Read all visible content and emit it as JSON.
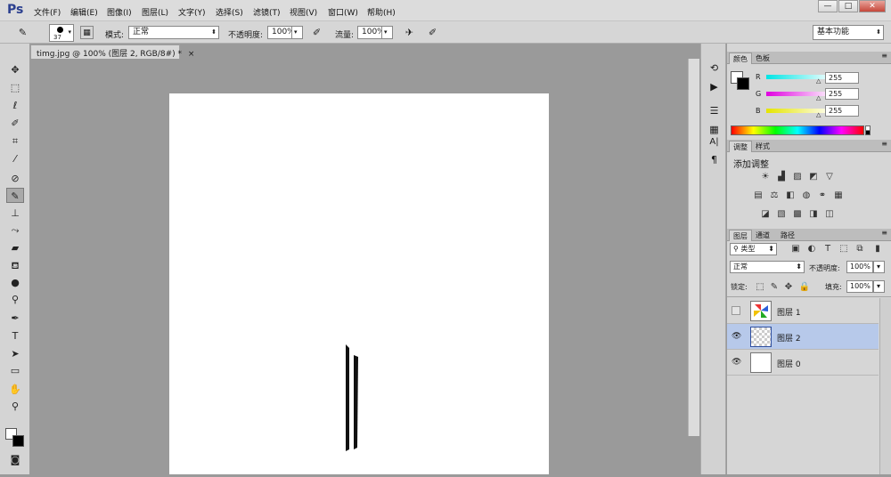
{
  "app": {
    "logo": "Ps"
  },
  "menu": [
    "文件(F)",
    "编辑(E)",
    "图像(I)",
    "图层(L)",
    "文字(Y)",
    "选择(S)",
    "滤镜(T)",
    "视图(V)",
    "窗口(W)",
    "帮助(H)"
  ],
  "window_controls": {
    "minimize": "—",
    "maximize": "□",
    "close": "✕"
  },
  "options": {
    "brush_size": "37",
    "mode_label": "模式:",
    "mode_value": "正常",
    "opacity_label": "不透明度:",
    "opacity_value": "100%",
    "flow_label": "流量:",
    "flow_value": "100%",
    "workspace": "基本功能"
  },
  "document": {
    "tab_title": "timg.jpg @ 100% (图层 2, RGB/8#) *"
  },
  "tools": [
    "move-icon",
    "marquee-icon",
    "lasso-icon",
    "quick-select-icon",
    "crop-icon",
    "eyedropper-icon",
    "healing-icon",
    "brush-icon",
    "stamp-icon",
    "history-brush-icon",
    "eraser-icon",
    "paint-bucket-icon",
    "blur-icon",
    "dodge-icon",
    "pen-icon",
    "type-icon",
    "path-select-icon",
    "shape-icon",
    "hand-icon",
    "zoom-icon"
  ],
  "color_panel": {
    "tabs": [
      "颜色",
      "色板"
    ],
    "channels": [
      {
        "label": "R",
        "value": "255",
        "color": "#00e5e5"
      },
      {
        "label": "G",
        "value": "255",
        "color": "#e000e0"
      },
      {
        "label": "B",
        "value": "255",
        "color": "#e5e500"
      }
    ]
  },
  "adjustments_panel": {
    "tabs": [
      "调整",
      "样式"
    ],
    "title": "添加调整"
  },
  "layers_panel": {
    "tabs": [
      "图层",
      "通道",
      "路径"
    ],
    "filter_label": "类型",
    "blend_mode": "正常",
    "opacity_label": "不透明度:",
    "opacity_value": "100%",
    "lock_label": "锁定:",
    "fill_label": "填充:",
    "fill_value": "100%",
    "layers": [
      {
        "name": "图层 1",
        "visible": false,
        "selected": false
      },
      {
        "name": "图层 2",
        "visible": true,
        "selected": true
      },
      {
        "name": "图层 0",
        "visible": true,
        "selected": false
      }
    ]
  }
}
